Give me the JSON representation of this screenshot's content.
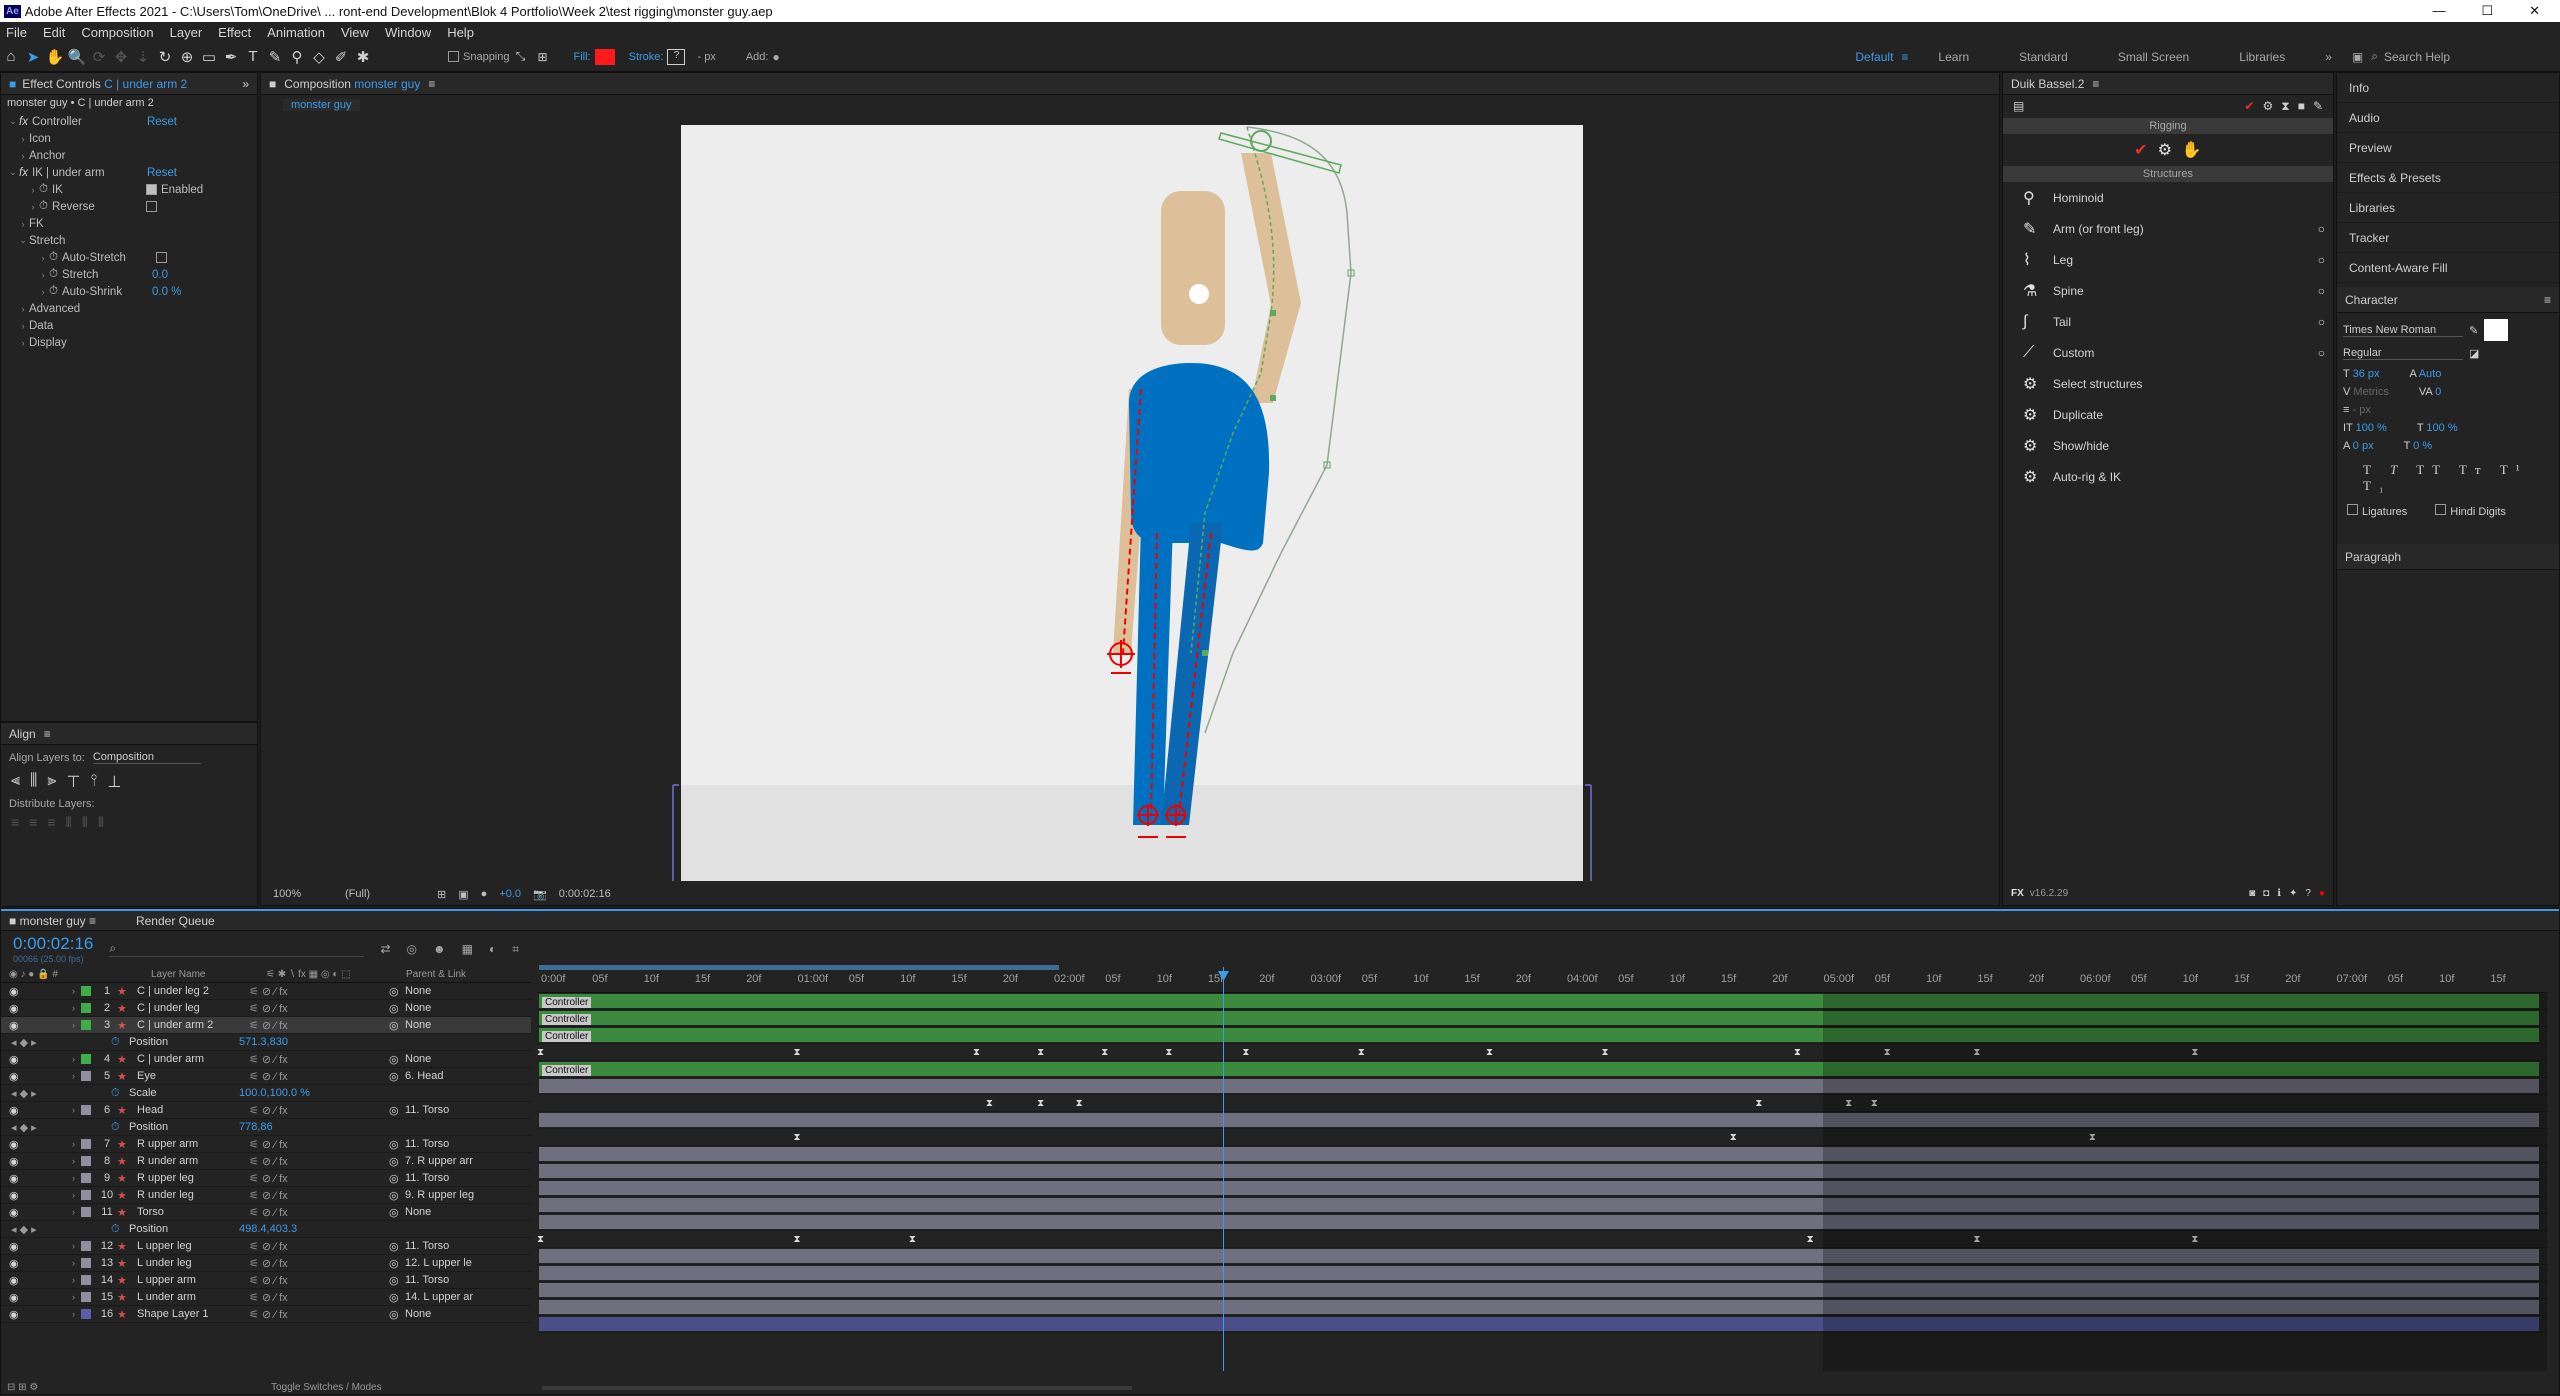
{
  "window": {
    "app_icon": "Ae",
    "title": "Adobe After Effects 2021 - C:\\Users\\Tom\\OneDrive\\ ... ront-end Development\\Blok 4 Portfolio\\Week 2\\test rigging\\monster guy.aep",
    "min": "—",
    "max": "☐",
    "close": "✕"
  },
  "menu": [
    "File",
    "Edit",
    "Composition",
    "Layer",
    "Effect",
    "Animation",
    "View",
    "Window",
    "Help"
  ],
  "toolbar": {
    "snapping": "Snapping",
    "fill": "Fill:",
    "stroke": "Stroke:",
    "stroke_px": "- px",
    "add": "Add:",
    "workspaces": [
      "Default",
      "Learn",
      "Standard",
      "Small Screen",
      "Libraries"
    ],
    "search": "Search Help"
  },
  "effect_controls": {
    "tab": "Effect Controls",
    "tab_layer": "C | under arm 2",
    "subtitle": "monster guy • C | under arm 2",
    "rows": [
      {
        "label": "Controller",
        "link": "Reset",
        "ind": 0,
        "fx": true
      },
      {
        "label": "Icon",
        "ind": 1
      },
      {
        "label": "Anchor",
        "ind": 1
      },
      {
        "label": "IK | under arm",
        "link": "Reset",
        "ind": 0,
        "fx": true
      },
      {
        "label": "IK",
        "check": "Enabled",
        "ind": 2
      },
      {
        "label": "Reverse",
        "check": "",
        "ind": 2
      },
      {
        "label": "FK",
        "ind": 1
      },
      {
        "label": "Stretch",
        "ind": 1
      },
      {
        "label": "Auto-Stretch",
        "check": "",
        "ind": 3
      },
      {
        "label": "Stretch",
        "value": "0.0",
        "ind": 3
      },
      {
        "label": "Auto-Shrink",
        "value": "0.0 %",
        "ind": 3
      },
      {
        "label": "Advanced",
        "ind": 1
      },
      {
        "label": "Data",
        "ind": 1
      },
      {
        "label": "Display",
        "ind": 1
      }
    ]
  },
  "align": {
    "title": "Align",
    "align_to_label": "Align Layers to:",
    "align_to_value": "Composition",
    "distribute": "Distribute Layers:"
  },
  "composition": {
    "tab": "Composition",
    "tab_name": "monster guy",
    "breadcrumb": "monster guy",
    "zoom": "100%",
    "resolution": "(Full)",
    "exposure": "+0.0",
    "timecode": "0:00:02:16"
  },
  "duik": {
    "title": "Duik Bassel.2",
    "rigging": "Rigging",
    "structures_title": "Structures",
    "items": [
      "Hominoid",
      "Arm (or front leg)",
      "Leg",
      "Spine",
      "Tail",
      "Custom",
      "Select structures",
      "Duplicate",
      "Show/hide",
      "Auto-rig & IK"
    ],
    "version": "v16.2.29"
  },
  "right_panels": [
    "Info",
    "Audio",
    "Preview",
    "Effects & Presets",
    "Libraries",
    "Tracker",
    "Content-Aware Fill"
  ],
  "character": {
    "title": "Character",
    "font": "Times New Roman",
    "style": "Regular",
    "size": "36 px",
    "leading": "Auto",
    "kerning": "Metrics",
    "tracking": "0",
    "stroke_width": "- px",
    "vscale": "100 %",
    "hscale": "100 %",
    "baseline": "0 px",
    "tsume": "0 %",
    "ligatures": "Ligatures",
    "hindi": "Hindi Digits",
    "paragraph": "Paragraph"
  },
  "timeline": {
    "tab": "monster guy",
    "render_tab": "Render Queue",
    "timecode": "0:00:02:16",
    "frames": "00066 (25.00 fps)",
    "col_layer": "Layer Name",
    "col_parent": "Parent & Link",
    "toggle": "Toggle Switches / Modes",
    "ruler": [
      "0:00f",
      "05f",
      "10f",
      "15f",
      "20f",
      "01:00f",
      "05f",
      "10f",
      "15f",
      "20f",
      "02:00f",
      "05f",
      "10f",
      "15f",
      "20f",
      "03:00f",
      "05f",
      "10f",
      "15f",
      "20f",
      "04:00f",
      "05f",
      "10f",
      "15f",
      "20f",
      "05:00f",
      "05f",
      "10f",
      "15f",
      "20f",
      "06:00f",
      "05f",
      "10f",
      "15f",
      "20f",
      "07:00f",
      "05f",
      "10f",
      "15f"
    ],
    "rows": [
      {
        "num": "1",
        "name": "C | under leg 2",
        "parent": "None",
        "color": "#3fae49",
        "type": "layer",
        "bar": "Controller"
      },
      {
        "num": "2",
        "name": "C | under leg",
        "parent": "None",
        "color": "#3fae49",
        "type": "layer",
        "bar": "Controller"
      },
      {
        "num": "3",
        "name": "C | under arm 2",
        "parent": "None",
        "color": "#3fae49",
        "type": "layer",
        "bar": "Controller",
        "selected": true
      },
      {
        "name": "Position",
        "value": "571.3,830",
        "type": "prop",
        "keys": [
          0,
          10,
          17,
          19.5,
          22,
          24.5,
          27.5,
          32,
          37,
          41.5,
          49,
          52.5,
          56,
          64.5
        ]
      },
      {
        "num": "4",
        "name": "C | under arm",
        "parent": "None",
        "color": "#3fae49",
        "type": "layer",
        "bar": "Controller"
      },
      {
        "num": "5",
        "name": "Eye",
        "parent": "6. Head",
        "color": "#8f8f9f",
        "type": "layer"
      },
      {
        "name": "Scale",
        "value": "100.0,100.0 %",
        "type": "prop",
        "keys": [
          17.5,
          19.5,
          21,
          47.5,
          51,
          52
        ]
      },
      {
        "num": "6",
        "name": "Head",
        "parent": "11. Torso",
        "color": "#8f8f9f",
        "type": "layer"
      },
      {
        "name": "Position",
        "value": "778,86",
        "type": "prop",
        "keys": [
          10,
          46.5,
          60.5
        ]
      },
      {
        "num": "7",
        "name": "R upper arm",
        "parent": "11. Torso",
        "color": "#8f8f9f",
        "type": "layer"
      },
      {
        "num": "8",
        "name": "R under arm",
        "parent": "7. R upper arr",
        "color": "#8f8f9f",
        "type": "layer"
      },
      {
        "num": "9",
        "name": "R upper leg",
        "parent": "11. Torso",
        "color": "#8f8f9f",
        "type": "layer"
      },
      {
        "num": "10",
        "name": "R under leg",
        "parent": "9. R upper leg",
        "color": "#8f8f9f",
        "type": "layer"
      },
      {
        "num": "11",
        "name": "Torso",
        "parent": "None",
        "color": "#8f8f9f",
        "type": "layer"
      },
      {
        "name": "Position",
        "value": "498.4,403.3",
        "type": "prop",
        "keys": [
          0,
          10,
          14.5,
          49.5,
          56,
          64.5
        ]
      },
      {
        "num": "12",
        "name": "L upper leg",
        "parent": "11. Torso",
        "color": "#8f8f9f",
        "type": "layer"
      },
      {
        "num": "13",
        "name": "L under leg",
        "parent": "12. L upper le",
        "color": "#8f8f9f",
        "type": "layer"
      },
      {
        "num": "14",
        "name": "L upper arm",
        "parent": "11. Torso",
        "color": "#8f8f9f",
        "type": "layer"
      },
      {
        "num": "15",
        "name": "L under arm",
        "parent": "14. L upper ar",
        "color": "#8f8f9f",
        "type": "layer"
      },
      {
        "num": "16",
        "name": "Shape Layer 1",
        "parent": "None",
        "color": "#5a5fa8",
        "type": "layer"
      }
    ]
  }
}
